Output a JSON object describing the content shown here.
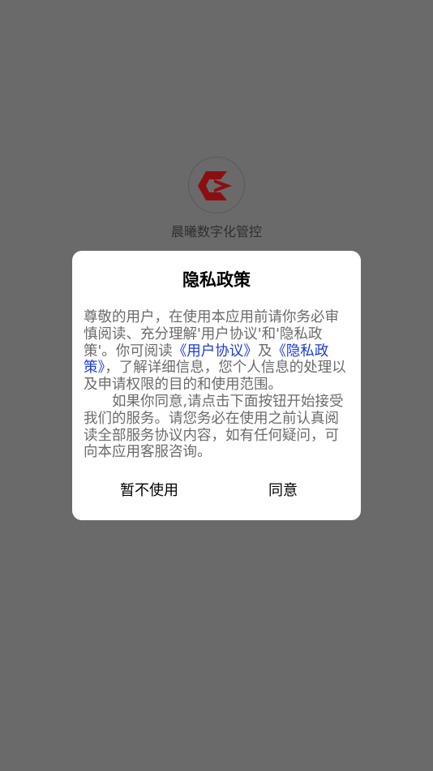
{
  "splash": {
    "app_name": "晨曦数字化管控",
    "logo_icon": "red-play-logo-icon",
    "colors": {
      "overlay": "#6a6a6a",
      "logo": "#8b0f12"
    }
  },
  "dialog": {
    "title": "隐私政策",
    "para1": {
      "part1": "尊敬的用户，在使用本应用前请你务必审慎阅读、充分理解'用户协议'和'隐私政策'。你可阅读",
      "link_user_agreement": "《用户协议》",
      "and": "及",
      "link_privacy_policy": "《隐私政策》",
      "part2": "，了解详细信息，您个人信息的处理以及申请权限的目的和使用范围。"
    },
    "para2": "如果你同意,请点击下面按钮开始接受我们的服务。请您务必在使用之前认真阅读全部服务协议内容，如有任何疑问，可向本应用客服咨询。",
    "decline_label": "暂不使用",
    "agree_label": "同意",
    "colors": {
      "link": "#1a3adf",
      "body_text": "#6b6b6b"
    }
  }
}
